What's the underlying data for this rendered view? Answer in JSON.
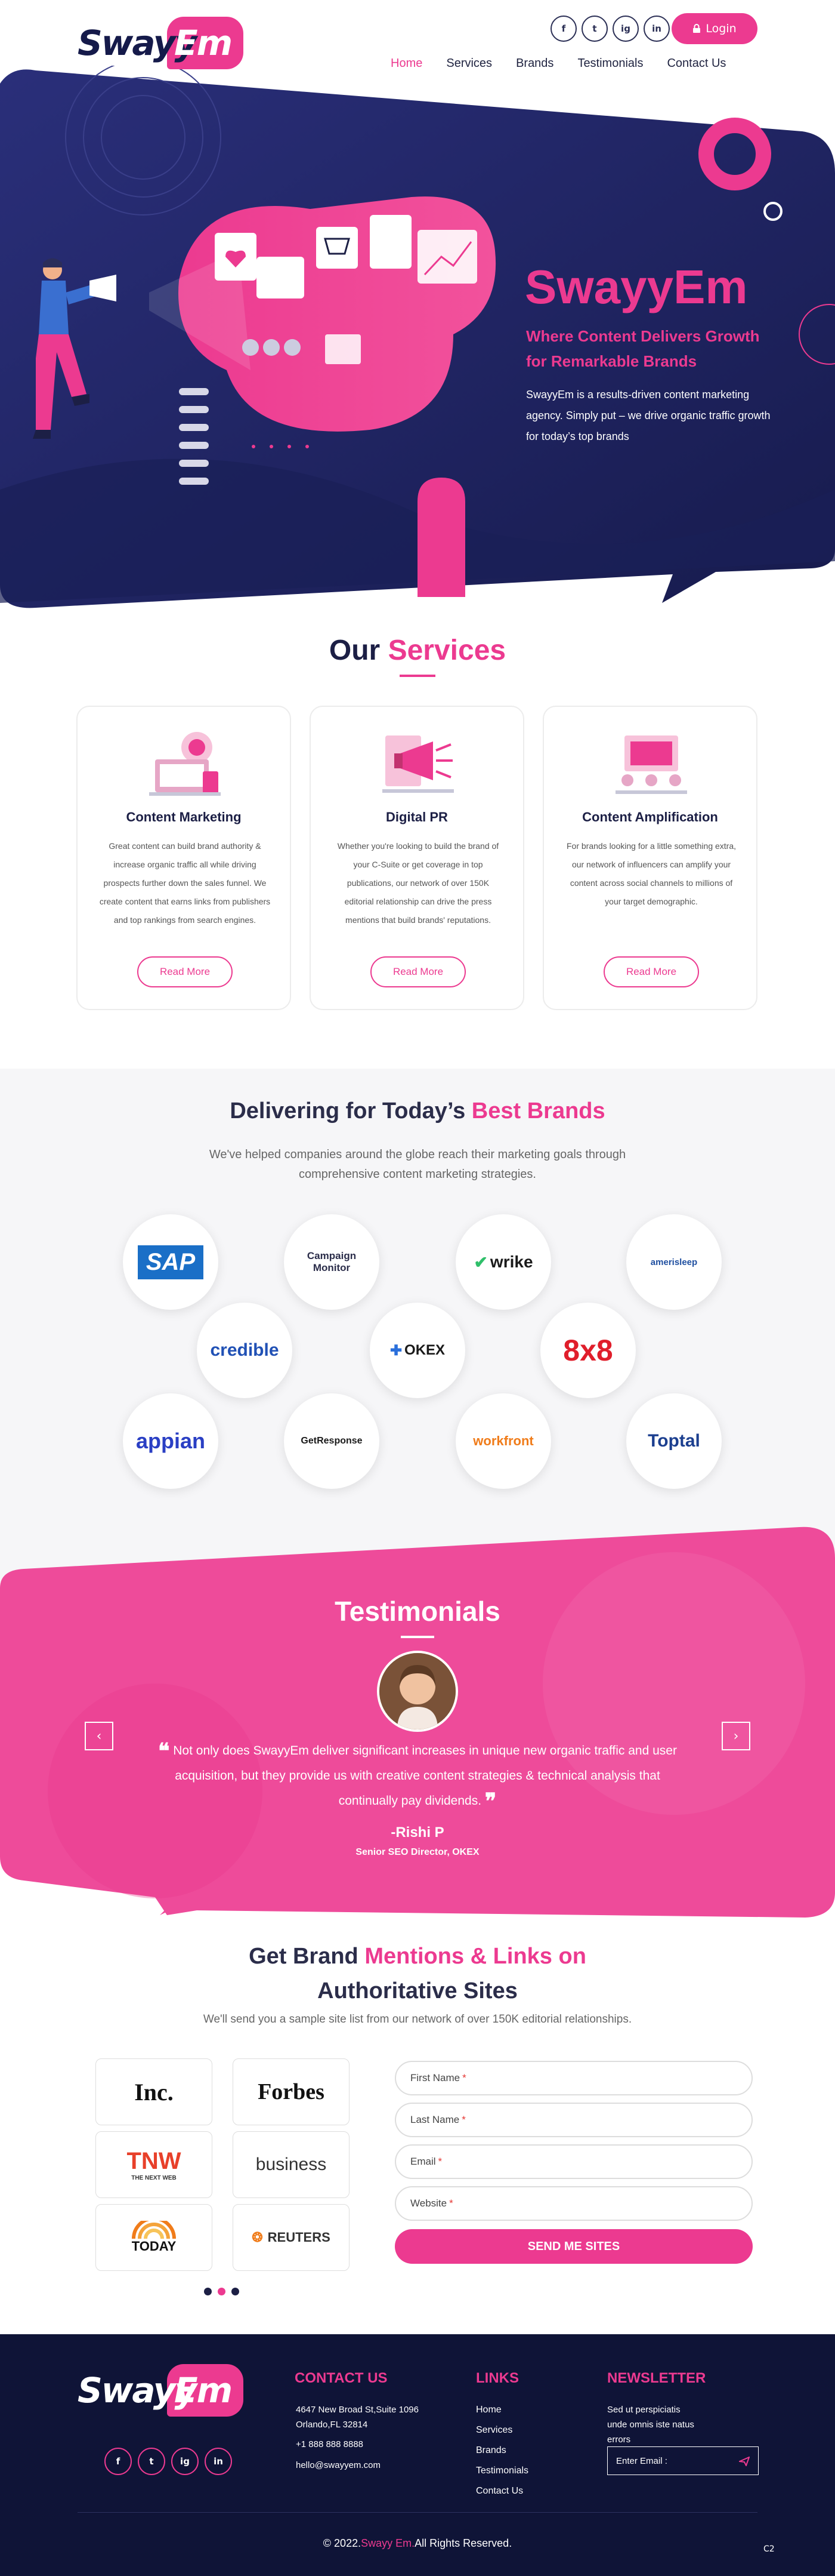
{
  "brand": {
    "logo_part1": "Swayy",
    "logo_part2": "Em"
  },
  "header": {
    "social": [
      "f",
      "t",
      "ig",
      "in"
    ],
    "login_label": "Login",
    "nav": [
      {
        "label": "Home",
        "active": true
      },
      {
        "label": "Services",
        "active": false
      },
      {
        "label": "Brands",
        "active": false
      },
      {
        "label": "Testimonials",
        "active": false
      },
      {
        "label": "Contact Us",
        "active": false
      }
    ]
  },
  "hero": {
    "title": "SwayyEm",
    "subtitle": "Where Content Delivers Growth for Remarkable Brands",
    "description": "SwayyEm is a results-driven content marketing agency. Simply put – we drive organic traffic growth for today’s top brands"
  },
  "services": {
    "title_part1": "Our",
    "title_part2": "Services",
    "cards": [
      {
        "title": "Content Marketing",
        "text": "Great content can build brand  authority & increase organic traffic all while driving prospects further down the sales funnel. We create content that earns links from publishers and top rankings from search engines.",
        "button": "Read More"
      },
      {
        "title": "Digital PR",
        "text": "Whether you're looking to build the brand of your C-Suite or get coverage in top publications, our network of over 150K editorial relationship can drive the press mentions that build brands' reputations.",
        "button": "Read More"
      },
      {
        "title": "Content Amplification",
        "text": "For brands looking for a little  something extra, our network of influencers can amplify your content across social channels to millions of your target demographic.",
        "button": "Read More"
      }
    ]
  },
  "brands": {
    "title_part1": "Delivering for Today’s",
    "title_part2": "Best Brands",
    "description": "We've helped companies around the globe reach their marketing goals through comprehensive content marketing strategies.",
    "logos": [
      {
        "name": "SAP",
        "color": "#1a6fc7"
      },
      {
        "name": "Campaign Monitor",
        "color": "#2b2d4a"
      },
      {
        "name": "wrike",
        "color": "#1a1a1a"
      },
      {
        "name": "amerisleep",
        "color": "#1f4fa0"
      },
      {
        "name": "credible",
        "color": "#2151b5"
      },
      {
        "name": "OKEX",
        "color": "#1a1a1a"
      },
      {
        "name": "8x8",
        "color": "#e01e2b"
      },
      {
        "name": "appian",
        "color": "#2a3fc4"
      },
      {
        "name": "GetResponse",
        "color": "#1a1a1a"
      },
      {
        "name": "workfront",
        "color": "#f07c1a"
      },
      {
        "name": "Toptal",
        "color": "#1c3f8f"
      }
    ]
  },
  "testimonials": {
    "title": "Testimonials",
    "quote": "Not only does SwayyEm deliver significant increases in unique new organic traffic and user acquisition, but they provide us with creative content strategies & technical analysis that continually pay dividends.",
    "name": "-Rishi P",
    "role": "Senior SEO Director, OKEX",
    "prev": "‹",
    "next": "›"
  },
  "get_brand": {
    "title_part1": "Get Brand",
    "title_part2": "Mentions & Links on",
    "title_part3": "Authoritative Sites",
    "description": "We'll send you a sample site list from our network of over  150K editorial relationships.",
    "publications": [
      "Inc.",
      "Forbes",
      "TNW",
      "THE NEXT WEB",
      "business",
      "TODAY",
      "REUTERS"
    ],
    "form": {
      "first_name": "First Name",
      "last_name": "Last Name",
      "email": "Email",
      "website": "Website",
      "required_mark": "*",
      "submit": "SEND ME SITES"
    }
  },
  "footer": {
    "contact_heading": "CONTACT US",
    "address_line1": "4647 New Broad St,Suite 1096",
    "address_line2": "Orlando,FL 32814",
    "phone": "+1 888 888 8888",
    "email": "hello@swayyem.com",
    "links_heading": "LINKS",
    "links": [
      "Home",
      "Services",
      "Brands",
      "Testimonials",
      "Contact Us"
    ],
    "newsletter_heading": "NEWSLETTER",
    "newsletter_text": "Sed ut perspiciatis unde omnis iste natus errors",
    "email_placeholder": "Enter Email :",
    "copyright_prefix": "© 2022.",
    "copyright_brand": "Swayy Em.",
    "copyright_suffix": "All Rights Reserved.",
    "badge": "C2"
  },
  "colors": {
    "accent": "#ec3a90",
    "navy": "#151a4a",
    "hero_bg": "#1f2463"
  }
}
